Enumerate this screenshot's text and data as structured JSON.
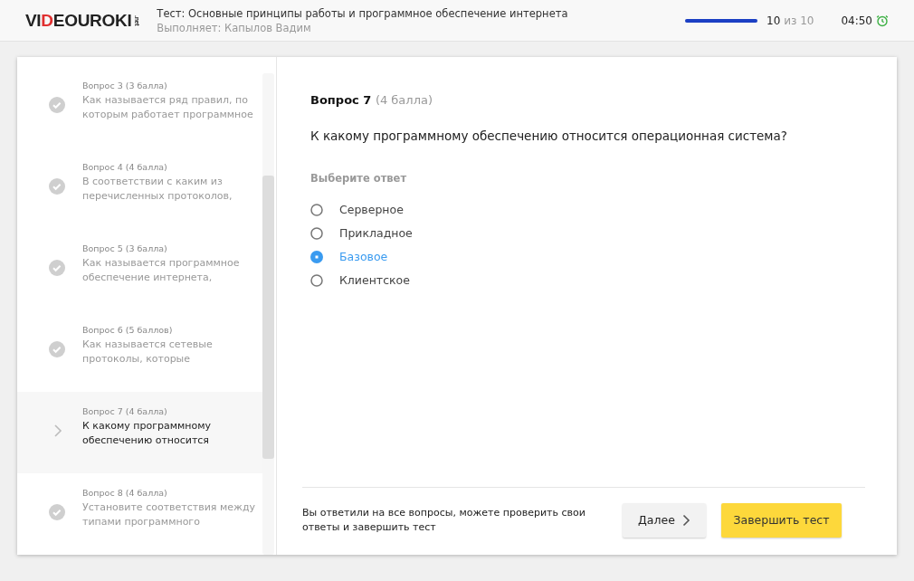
{
  "header": {
    "logo": [
      {
        "text": "VI",
        "accent": false
      },
      {
        "text": "D",
        "accent": true
      },
      {
        "text": "EOUROKI",
        "accent": false
      }
    ],
    "logo_suffix": ".net",
    "title": "Тест: Основные принципы работы и программное обеспечение интернета",
    "subtitle": "Выполняет: Капылов Вадим",
    "progress": {
      "level": 1.0,
      "done": "10",
      "of": "из 10"
    },
    "timer": "04:50"
  },
  "sidebar": {
    "items": [
      {
        "label": "Вопрос 3 (3 балла)",
        "text": "Как называется ряд правил, по которым работает программное",
        "kind": "answered",
        "selected": false
      },
      {
        "label": "Вопрос 4 (4 балла)",
        "text": "В соответствии с каким из перечисленных протоколов,",
        "kind": "answered",
        "selected": false
      },
      {
        "label": "Вопрос 5 (3 балла)",
        "text": "Как называется программное обеспечение интернета,",
        "kind": "answered",
        "selected": false
      },
      {
        "label": "Вопрос 6 (5 баллов)",
        "text": "Как называется сетевые протоколы, которые",
        "kind": "answered",
        "selected": false
      },
      {
        "label": "Вопрос 7 (4 балла)",
        "text": "К какому программному обеспечению относится",
        "kind": "current",
        "selected": true
      },
      {
        "label": "Вопрос 8 (4 балла)",
        "text": "Установите соответствия между типами программного",
        "kind": "answered",
        "selected": false
      }
    ]
  },
  "question": {
    "number": "Вопрос 7",
    "points": "(4 балла)",
    "text": "К какому программному обеспечению относится операционная система?",
    "prompt": "Выберите ответ",
    "options": [
      {
        "label": "Серверное",
        "selected": false
      },
      {
        "label": "Прикладное",
        "selected": false
      },
      {
        "label": "Базовое",
        "selected": true
      },
      {
        "label": "Клиентское",
        "selected": false
      }
    ]
  },
  "footer": {
    "note": "Вы ответили на все вопросы, можете проверить свои ответы и завершить тест",
    "next": "Далее",
    "finish": "Завершить тест"
  }
}
